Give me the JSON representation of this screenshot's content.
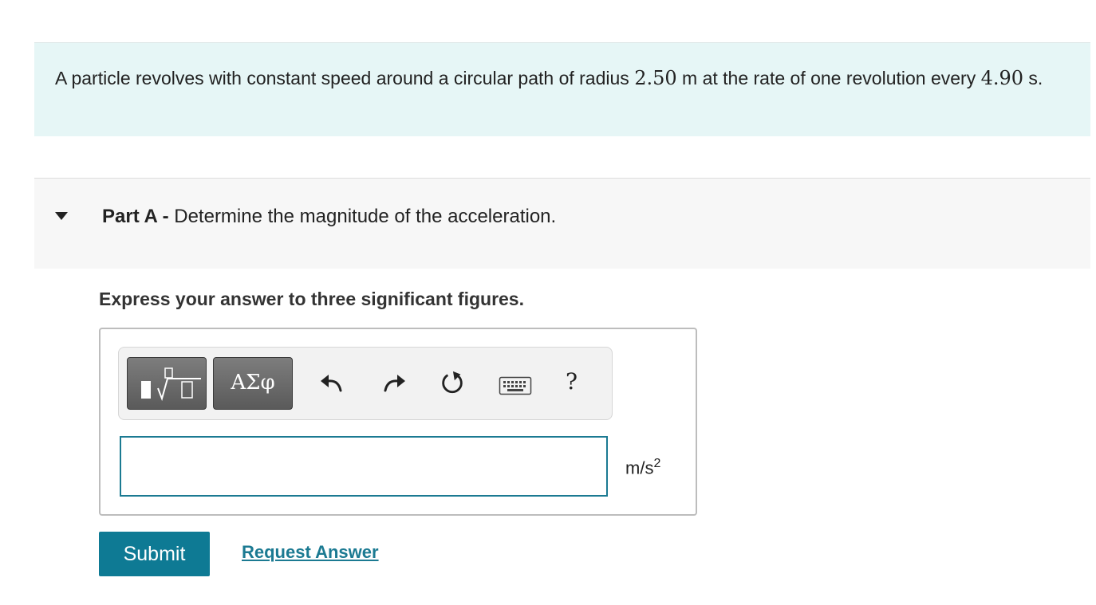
{
  "problem": {
    "text_before_radius": "A particle revolves with constant speed around a circular path of radius ",
    "radius_value": "2.50",
    "text_after_radius": " m at the rate of one revolution every ",
    "period_value": "4.90",
    "text_end": " s."
  },
  "part": {
    "label": "Part A -",
    "question": " Determine the magnitude of the acceleration."
  },
  "instructions": "Express your answer to three significant figures.",
  "toolbar": {
    "symbols_label": "ΑΣφ",
    "help_label": "?"
  },
  "answer": {
    "value": "",
    "units_base": "m/s",
    "units_exp": "2"
  },
  "actions": {
    "submit_label": "Submit",
    "request_answer_label": "Request Answer"
  },
  "colors": {
    "problem_bg": "#e6f6f6",
    "accent": "#0e7a94"
  }
}
